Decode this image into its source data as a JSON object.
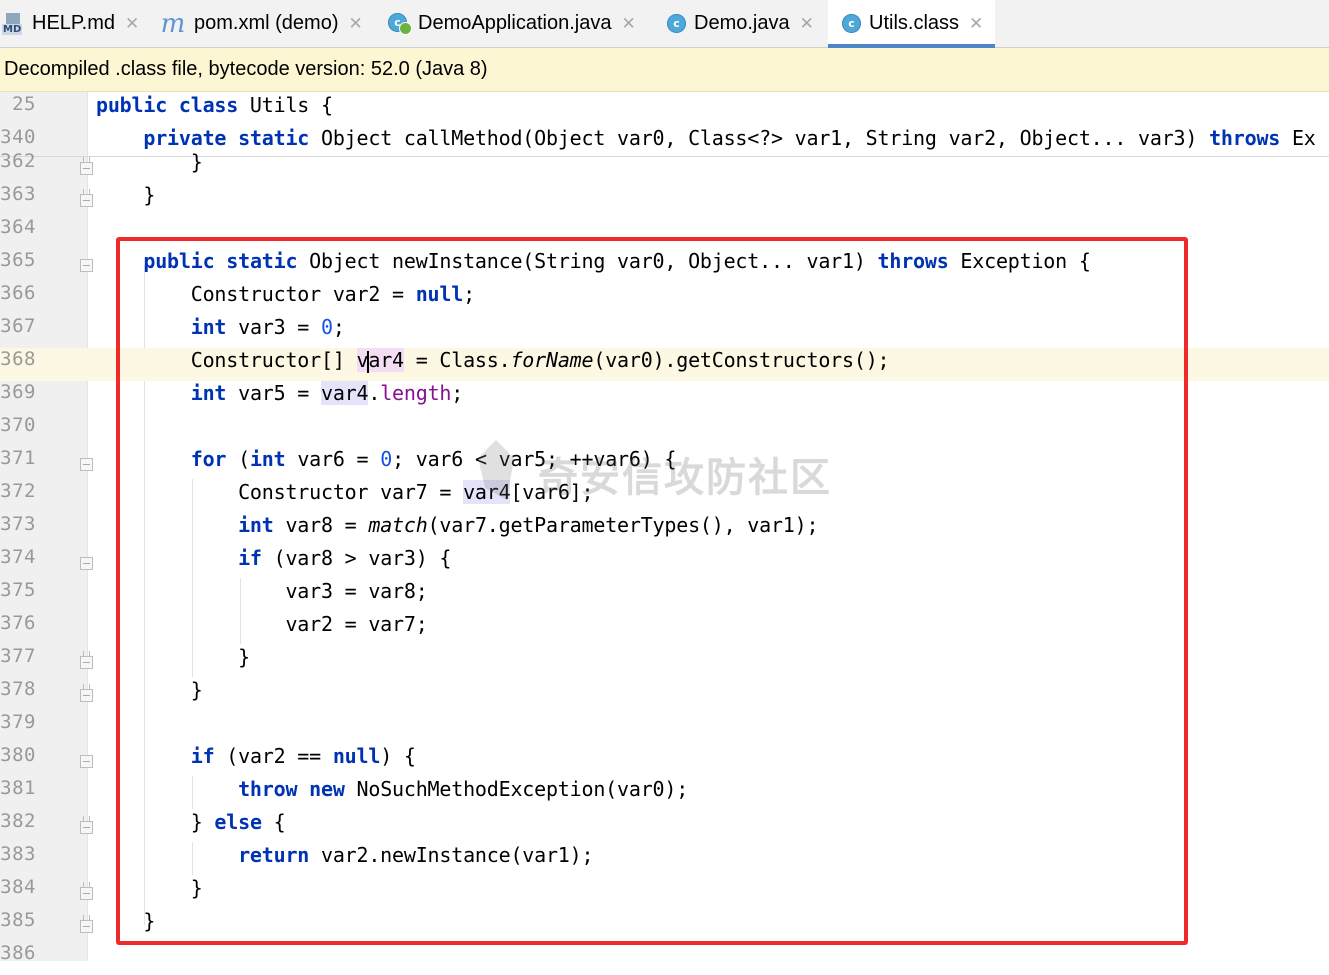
{
  "tabs": [
    {
      "label": "HELP.md",
      "icon": "markdown-file-icon",
      "active": false
    },
    {
      "label": "pom.xml (demo)",
      "icon": "maven-icon",
      "active": false
    },
    {
      "label": "DemoApplication.java",
      "icon": "spring-class-icon",
      "active": false
    },
    {
      "label": "Demo.java",
      "icon": "java-class-icon",
      "active": false
    },
    {
      "label": "Utils.class",
      "icon": "java-class-icon",
      "active": true
    }
  ],
  "tab_icons": {
    "md_badge": "MD",
    "maven_glyph": "m",
    "class_glyph": "c"
  },
  "close_glyph": "✕",
  "banner": {
    "text": "Decompiled .class file, bytecode version: 52.0 (Java 8)"
  },
  "colors": {
    "keyword": "#0033b3",
    "number": "#1750eb",
    "field": "#871094",
    "highlight_box": "#ee2a2a",
    "banner_bg": "#fdf6d2"
  },
  "editor": {
    "sticky_lines": [
      {
        "num": "25",
        "code": "public class Utils {"
      },
      {
        "num": "340",
        "code": "    private static Object callMethod(Object var0, Class<?> var1, String var2, Object... var3) throws Ex"
      }
    ],
    "lines": [
      {
        "num": "362",
        "code": "        }"
      },
      {
        "num": "363",
        "code": "    }"
      },
      {
        "num": "364",
        "code": ""
      },
      {
        "num": "365",
        "code": "    public static Object newInstance(String var0, Object... var1) throws Exception {"
      },
      {
        "num": "366",
        "code": "        Constructor var2 = null;"
      },
      {
        "num": "367",
        "code": "        int var3 = 0;"
      },
      {
        "num": "368",
        "code": "        Constructor[] var4 = Class.forName(var0).getConstructors();"
      },
      {
        "num": "369",
        "code": "        int var5 = var4.length;"
      },
      {
        "num": "370",
        "code": ""
      },
      {
        "num": "371",
        "code": "        for (int var6 = 0; var6 < var5; ++var6) {"
      },
      {
        "num": "372",
        "code": "            Constructor var7 = var4[var6];"
      },
      {
        "num": "373",
        "code": "            int var8 = match(var7.getParameterTypes(), var1);"
      },
      {
        "num": "374",
        "code": "            if (var8 > var3) {"
      },
      {
        "num": "375",
        "code": "                var3 = var8;"
      },
      {
        "num": "376",
        "code": "                var2 = var7;"
      },
      {
        "num": "377",
        "code": "            }"
      },
      {
        "num": "378",
        "code": "        }"
      },
      {
        "num": "379",
        "code": ""
      },
      {
        "num": "380",
        "code": "        if (var2 == null) {"
      },
      {
        "num": "381",
        "code": "            throw new NoSuchMethodException(var0);"
      },
      {
        "num": "382",
        "code": "        } else {"
      },
      {
        "num": "383",
        "code": "            return var2.newInstance(var1);"
      },
      {
        "num": "384",
        "code": "        }"
      },
      {
        "num": "385",
        "code": "    }"
      },
      {
        "num": "386",
        "code": ""
      }
    ],
    "current_line": "368"
  },
  "watermark": {
    "text": "奇安信攻防社区"
  }
}
